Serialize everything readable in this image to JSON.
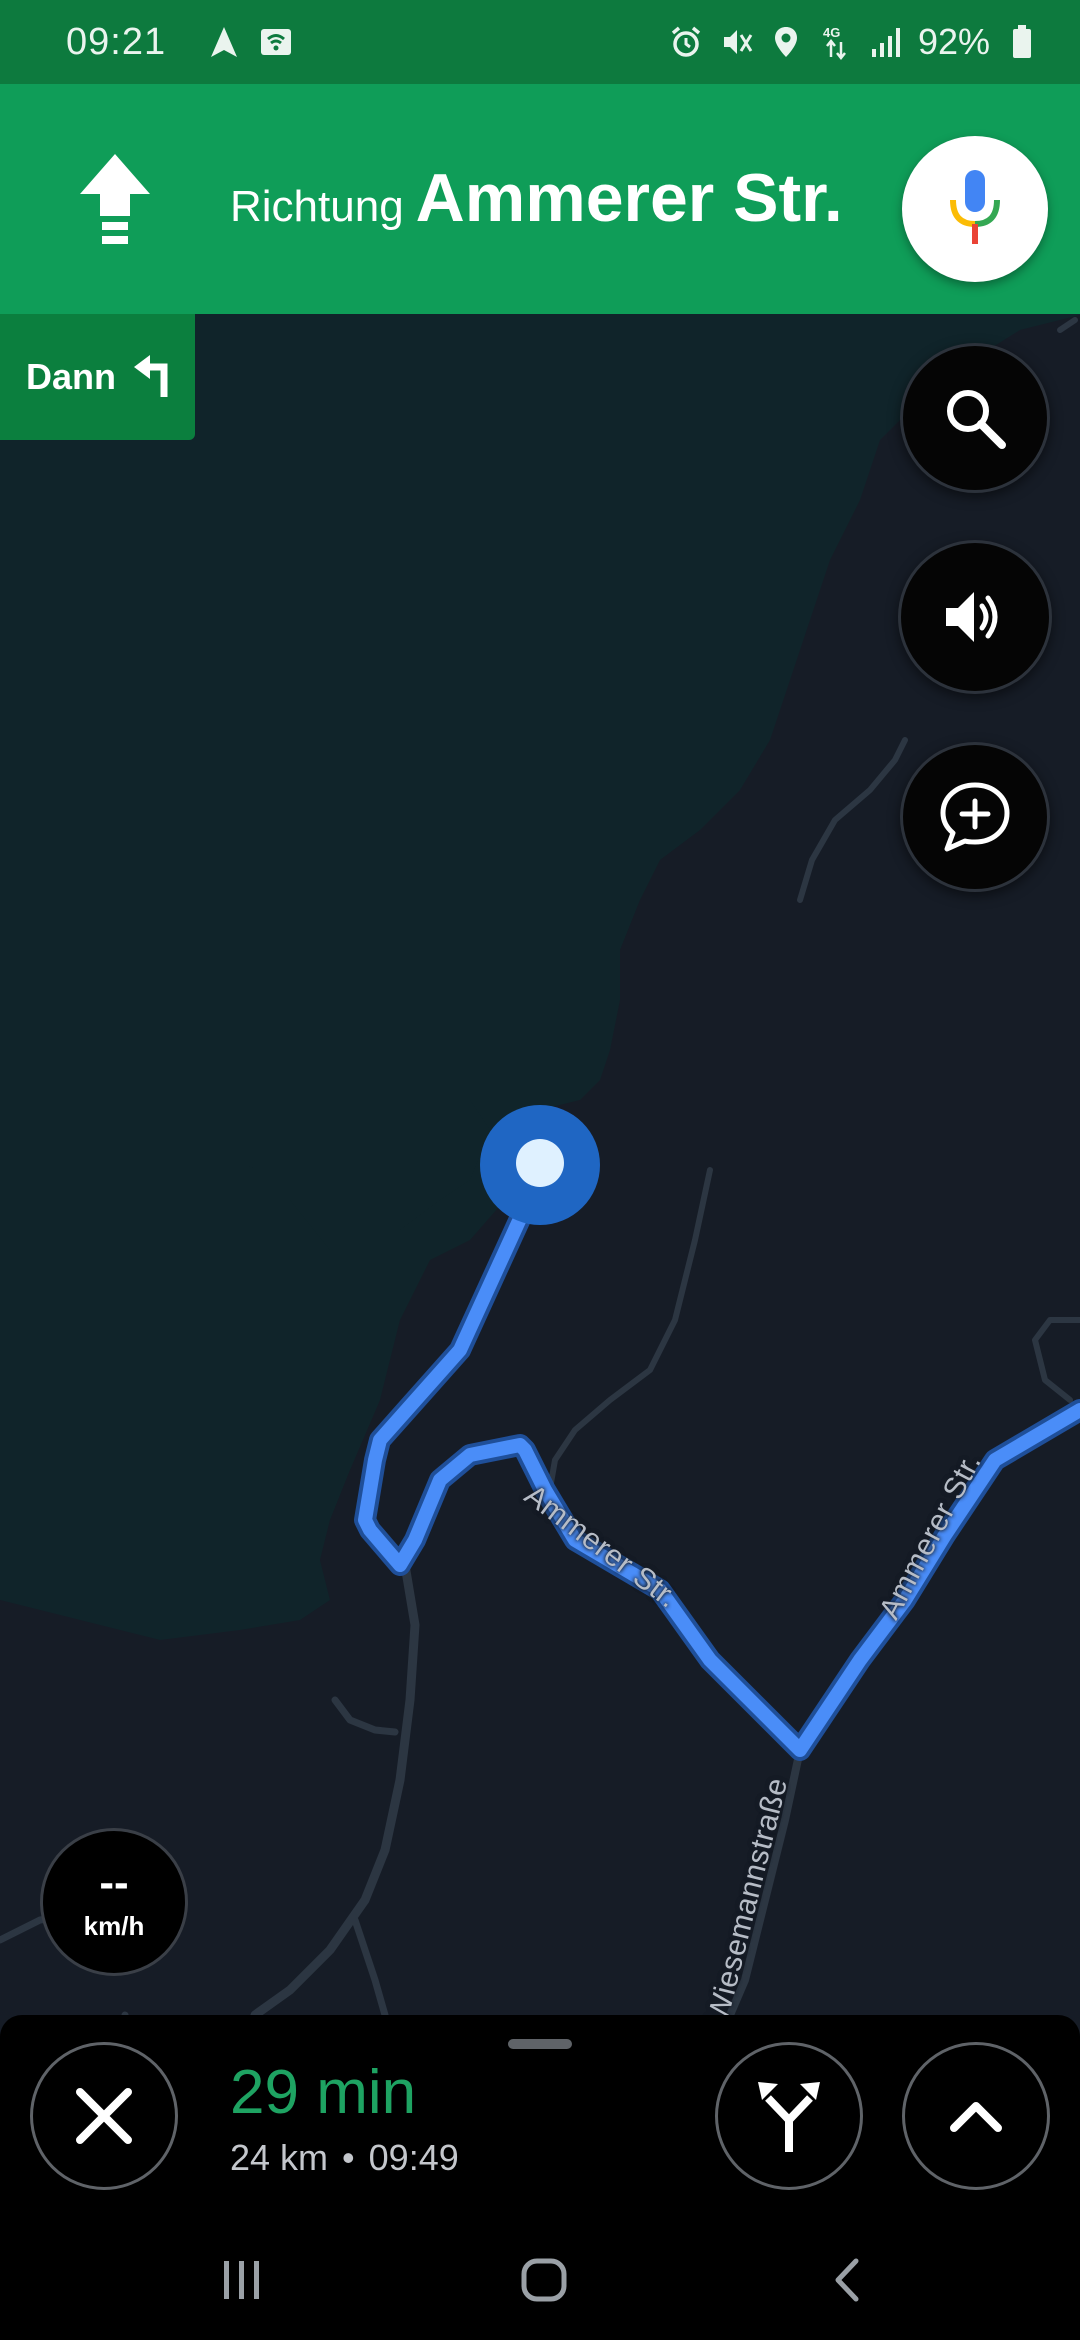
{
  "status_bar": {
    "time": "09:21",
    "battery": "92%",
    "left_icons": [
      "navigation-arrow-icon",
      "wifi-hotspot-icon"
    ],
    "right_icons": [
      "alarm-icon",
      "mute-icon",
      "location-icon",
      "4g-data-icon",
      "signal-icon",
      "battery-icon"
    ]
  },
  "navigation": {
    "direction_prefix": "Richtung",
    "street": "Ammerer Str.",
    "maneuver_icon": "straight-arrow-icon",
    "then_label": "Dann",
    "then_icon": "turn-left-icon"
  },
  "map": {
    "street_labels": [
      "Ammerer Str.",
      "Ammerer Str.",
      "Wiesemannstraße"
    ],
    "colors": {
      "route": "#4a8df8",
      "forest": "#10242a",
      "land": "#161c26",
      "road": "#2c3642",
      "position_dot": "#1f66c3"
    }
  },
  "speed": {
    "value": "--",
    "unit": "km/h"
  },
  "trip": {
    "duration": "29 min",
    "distance": "24 km",
    "separator": "•",
    "arrival": "09:49"
  },
  "colors": {
    "status_bar": "#0d7a3e",
    "banner": "#0f9d58",
    "then_chip": "#0b7f3e",
    "eta_green": "#1ea362"
  }
}
